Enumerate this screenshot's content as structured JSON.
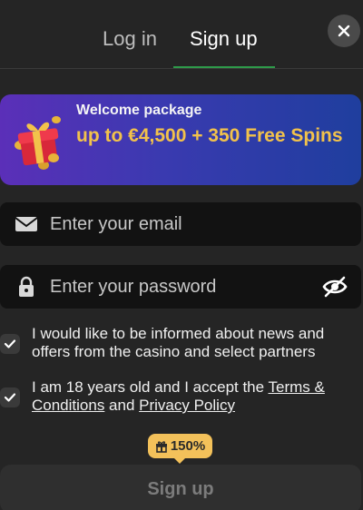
{
  "tabs": {
    "login": "Log in",
    "signup": "Sign up",
    "active": "signup"
  },
  "banner": {
    "title": "Welcome package",
    "offer": "up to €4,500 + 350 Free Spins"
  },
  "form": {
    "email_placeholder": "Enter your email",
    "password_placeholder": "Enter your password"
  },
  "consents": {
    "news": {
      "checked": true,
      "text": "I would like to be informed about news and offers from the casino and select partners"
    },
    "terms": {
      "checked": true,
      "prefix": "I am 18 years old and I accept the ",
      "terms_link": "Terms & Conditions",
      "joiner": " and ",
      "privacy_link": "Privacy Policy"
    }
  },
  "bonus_badge": "150%",
  "submit_label": "Sign up",
  "icons": {
    "close": "close-icon",
    "gift": "gift-icon",
    "email": "envelope-icon",
    "password": "lock-icon",
    "visibility": "eye-off-icon",
    "check": "check-icon"
  },
  "colors": {
    "accent": "#2e9a4a",
    "offer": "#f2c24b",
    "badge": "#f3c15a",
    "background": "#252525",
    "input": "#121212"
  }
}
